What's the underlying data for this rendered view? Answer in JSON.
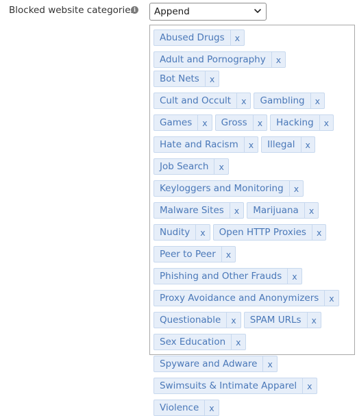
{
  "field": {
    "label": "Blocked website categories",
    "info_icon": "info-icon",
    "mode_select": {
      "value": "Append",
      "icon": "chevron-down-icon"
    }
  },
  "remove_label": "x",
  "tags": [
    "Abused Drugs",
    "Adult and Pornography",
    "Bot Nets",
    "Cult and Occult",
    "Gambling",
    "Games",
    "Gross",
    "Hacking",
    "Hate and Racism",
    "Illegal",
    "Job Search",
    "Keyloggers and Monitoring",
    "Malware Sites",
    "Marijuana",
    "Nudity",
    "Open HTTP Proxies",
    "Peer to Peer",
    "Phishing and Other Frauds",
    "Proxy Avoidance and Anonymizers",
    "Questionable",
    "SPAM URLs",
    "Sex Education",
    "Spyware and Adware",
    "Swimsuits & Intimate Apparel",
    "Violence"
  ],
  "colors": {
    "tag_bg": "#e6eef9",
    "tag_border": "#c7d8ee",
    "tag_text": "#4a78b8"
  }
}
